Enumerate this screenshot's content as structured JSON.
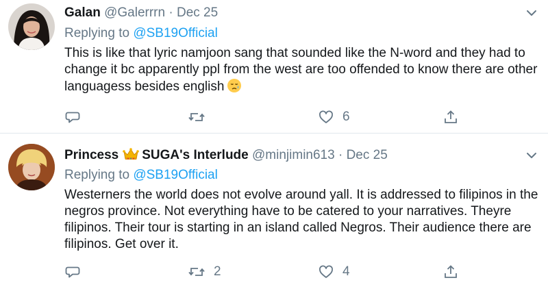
{
  "tweets": [
    {
      "display_name": "Galan",
      "handle": "@Galerrrn",
      "separator": "·",
      "date": "Dec 25",
      "replying_prefix": "Replying to",
      "replying_to": "@SB19Official",
      "text": "This is like that lyric namjoon sang that sounded like the N-word and they had to change it bc apparently ppl from the west are too offended to know there are other languagess besides english",
      "emoji": "sad-tear-face-emoji",
      "actions": {
        "reply_count": "",
        "retweet_count": "",
        "like_count": "6"
      }
    },
    {
      "display_name_part1": "Princess",
      "display_name_part2": "SUGA's Interlude",
      "crown_icon": "crown-emoji",
      "handle": "@minjimin613",
      "separator": "·",
      "date": "Dec 25",
      "replying_prefix": "Replying to",
      "replying_to": "@SB19Official",
      "text": "Westerners the world does not evolve around yall. It is addressed to filipinos in the negros province. Not everything have to be catered to your narratives. Theyre filipinos. Their tour is starting in an island called Negros. Their audience there are filipinos. Get over it.",
      "actions": {
        "reply_count": "",
        "retweet_count": "2",
        "like_count": "4"
      }
    }
  ],
  "colors": {
    "text_primary": "#14171a",
    "text_secondary": "#657786",
    "link": "#1da1f2",
    "divider": "#e1e8ed"
  }
}
